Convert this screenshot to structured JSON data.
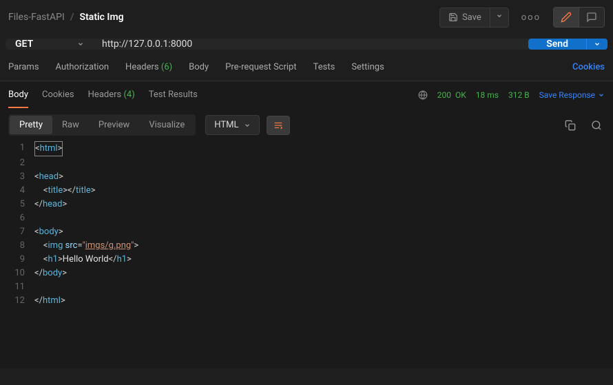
{
  "breadcrumb": {
    "collection": "Files-FastAPI",
    "sep": "/",
    "request": "Static Img"
  },
  "top": {
    "save": "Save",
    "meatball": "ooo"
  },
  "request": {
    "method": "GET",
    "url": "http://127.0.0.1:8000",
    "send": "Send"
  },
  "reqTabs": {
    "params": "Params",
    "auth": "Authorization",
    "headers": "Headers",
    "headersCount": "(6)",
    "body": "Body",
    "prereq": "Pre-request Script",
    "tests": "Tests",
    "settings": "Settings",
    "cookies": "Cookies"
  },
  "respTabs": {
    "body": "Body",
    "cookies": "Cookies",
    "headers": "Headers",
    "headersCount": "(4)",
    "testResults": "Test Results"
  },
  "respMeta": {
    "statusCode": "200",
    "statusText": "OK",
    "time": "18 ms",
    "size": "312 B",
    "saveResponse": "Save Response"
  },
  "viewTabs": {
    "pretty": "Pretty",
    "raw": "Raw",
    "preview": "Preview",
    "visualize": "Visualize"
  },
  "format": "HTML",
  "code": {
    "lines": [
      {
        "n": 1,
        "t": "html-open"
      },
      {
        "n": 2,
        "t": "blank"
      },
      {
        "n": 3,
        "t": "head-open"
      },
      {
        "n": 4,
        "t": "title"
      },
      {
        "n": 5,
        "t": "head-close"
      },
      {
        "n": 6,
        "t": "blank"
      },
      {
        "n": 7,
        "t": "body-open"
      },
      {
        "n": 8,
        "t": "img",
        "src": "imgs/g.png"
      },
      {
        "n": 9,
        "t": "h1",
        "text": "Hello World"
      },
      {
        "n": 10,
        "t": "body-close"
      },
      {
        "n": 11,
        "t": "blank"
      },
      {
        "n": 12,
        "t": "html-close"
      }
    ]
  }
}
